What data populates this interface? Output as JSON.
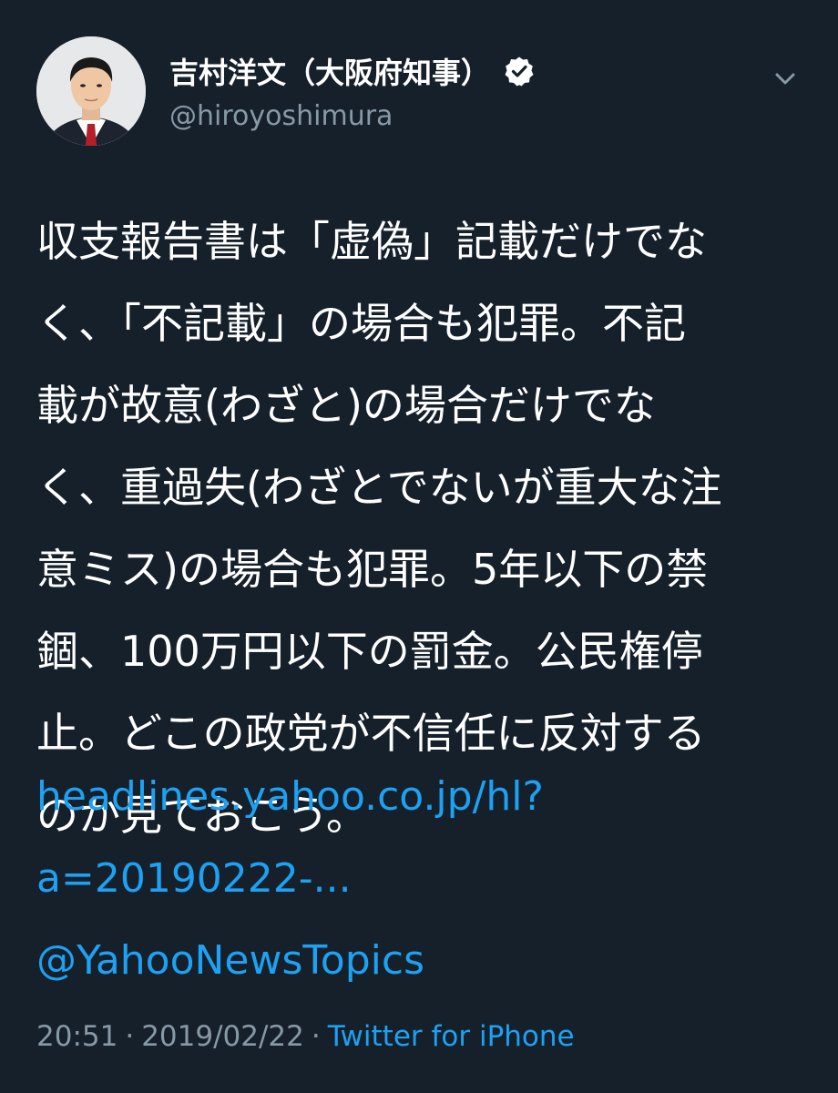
{
  "tweet": {
    "author": {
      "display_name": "吉村洋文（大阪府知事）",
      "handle": "@hiroyoshimura"
    },
    "text": "収支報告書は「虚偽」記載だけでな\nく、「不記載」の場合も犯罪。不記\n載が故意(わざと)の場合だけでな\nく、重過失(わざとでないが重大な注\n意ミス)の場合も犯罪。5年以下の禁\n錮、100万円以下の罰金。公民権停\n止。どこの政党が不信任に反対する\nのか見ておこう。",
    "link_line_1": "headlines.yahoo.co.jp/hl?",
    "link_line_2": "a=20190222-...",
    "mention": "@YahooNewsTopics",
    "time": "20:51",
    "date": "2019/02/22",
    "separator": "·",
    "source": "Twitter for iPhone"
  },
  "icons": {
    "verified": "verified-badge-icon",
    "more": "chevron-down-icon"
  },
  "colors": {
    "background": "#15202b",
    "link": "#1da1f2",
    "secondary_text": "#8899a6"
  }
}
